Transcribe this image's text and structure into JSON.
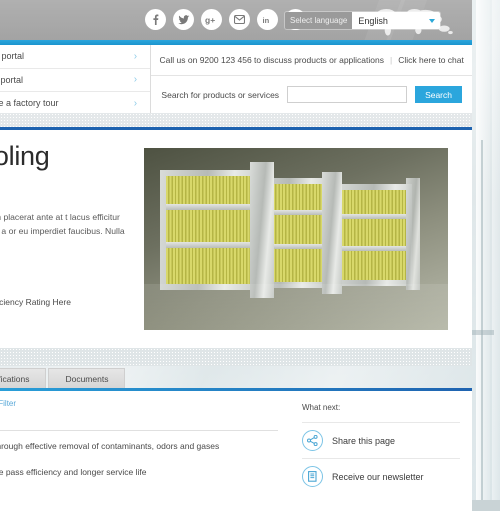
{
  "header": {
    "social_icons": [
      {
        "name": "facebook-icon",
        "glyph": "f"
      },
      {
        "name": "twitter-icon",
        "glyph": "t"
      },
      {
        "name": "google-plus-icon",
        "glyph": "g+"
      },
      {
        "name": "email-icon",
        "glyph": "@"
      },
      {
        "name": "linkedin-icon",
        "glyph": "in"
      },
      {
        "name": "pinterest-icon",
        "glyph": "P"
      }
    ],
    "language_label": "Select language",
    "language_value": "English",
    "world_map_alt": "world-map"
  },
  "utility": {
    "nav_items": [
      {
        "label": "Supplier portal"
      },
      {
        "label": "Careers portal"
      },
      {
        "label": "Schedule a factory tour"
      }
    ],
    "call_text": "Call us on 9200 123 456 to discuss products or applications",
    "chat_link": "Click here to chat",
    "search_label": "Search for products or services",
    "search_value": "",
    "search_placeholder": "",
    "search_button": "Search"
  },
  "hero": {
    "title": "Cooling",
    "body": "g elit. Nam placerat ante at t lacus efficitur efficitur. In a or eu imperdiet faucibus. Nulla",
    "efficiency_label": "Efficiency Rating Here",
    "image_alt": "air-filter-product-photo"
  },
  "tabs": [
    {
      "label": "Specifications",
      "active": true
    },
    {
      "label": "Documents",
      "active": false
    }
  ],
  "lower": {
    "breadcrumb": "et Cooling Filter",
    "bullets": [
      "ir quality through effective removal of contaminants, odors and gases",
      "mum single pass efficiency and longer service life"
    ],
    "what_next_title": "What next:",
    "what_next_items": [
      {
        "label": "Share this page",
        "icon": "share-icon"
      },
      {
        "label": "Receive our newsletter",
        "icon": "newsletter-icon"
      }
    ]
  },
  "colors": {
    "accent_blue": "#2ba6dd",
    "deep_blue": "#1f63b0",
    "header_grey": "#a8a8a8"
  }
}
